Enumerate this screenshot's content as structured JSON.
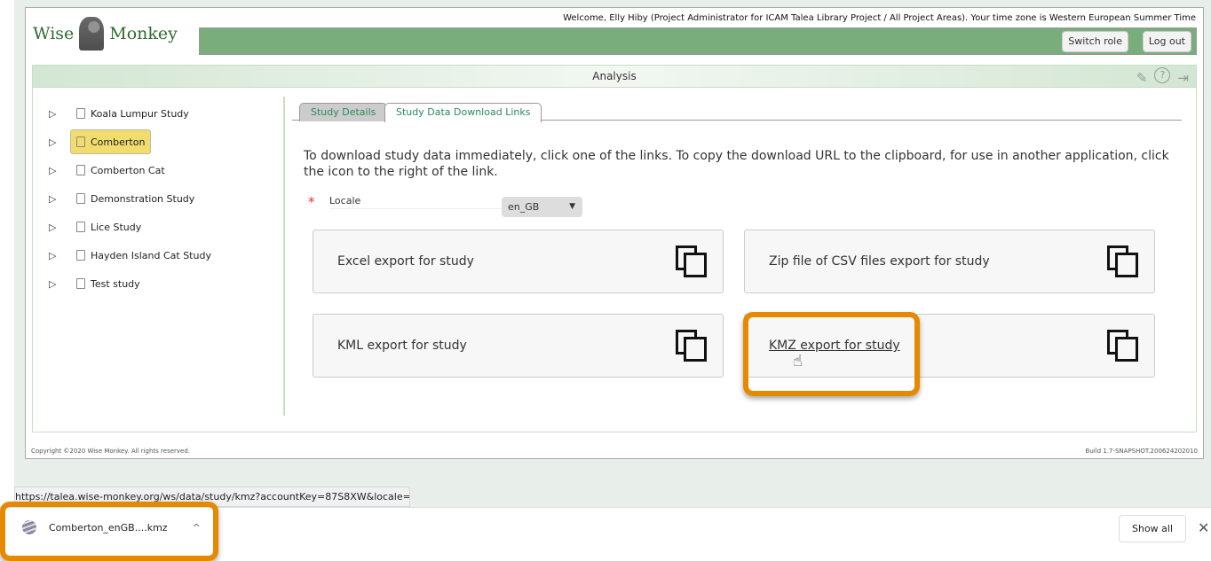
{
  "header": {
    "logo_left": "Wise",
    "logo_right": "Monkey",
    "welcome": "Welcome, Elly Hiby (Project Administrator for ICAM Talea Library Project / All Project Areas). Your time zone is Western European Summer Time",
    "switch_role": "Switch role",
    "log_out": "Log out"
  },
  "section_title": "Analysis",
  "sidebar": {
    "items": [
      {
        "label": "Koala Lumpur Study"
      },
      {
        "label": "Comberton",
        "selected": true
      },
      {
        "label": "Comberton Cat"
      },
      {
        "label": "Demonstration Study"
      },
      {
        "label": "Lice Study"
      },
      {
        "label": "Hayden Island Cat Study"
      },
      {
        "label": "Test study"
      }
    ]
  },
  "tabs": [
    {
      "label": "Study Details"
    },
    {
      "label": "Study Data Download Links",
      "active": true
    }
  ],
  "intro": "To download study data immediately, click one of the links. To copy the download URL to the clipboard, for use in another application, click the icon to the right of the link.",
  "locale": {
    "required_mark": "*",
    "label": "Locale",
    "value": "en_GB",
    "arrow": "▼"
  },
  "exports": [
    {
      "label": "Excel export for study"
    },
    {
      "label": "Zip file of CSV files export for study"
    },
    {
      "label": "KML export for study"
    },
    {
      "label": "KMZ export for study",
      "hovered": true
    }
  ],
  "footer": {
    "copyright": "Copyright ©2020 Wise Monkey. All rights reserved.",
    "build": "Build 1.7-SNAPSHOT.200624202010"
  },
  "status_url": "https://talea.wise-monkey.org/ws/data/study/kmz?accountKey=87S8XW&locale=...",
  "download": {
    "filename": "Comberton_enGB....kmz",
    "show_all": "Show all",
    "close": "✕",
    "chevron": "^"
  },
  "colors": {
    "accent_green": "#7aad7c",
    "highlight": "#e58a00",
    "selected": "#f2dc6e"
  }
}
